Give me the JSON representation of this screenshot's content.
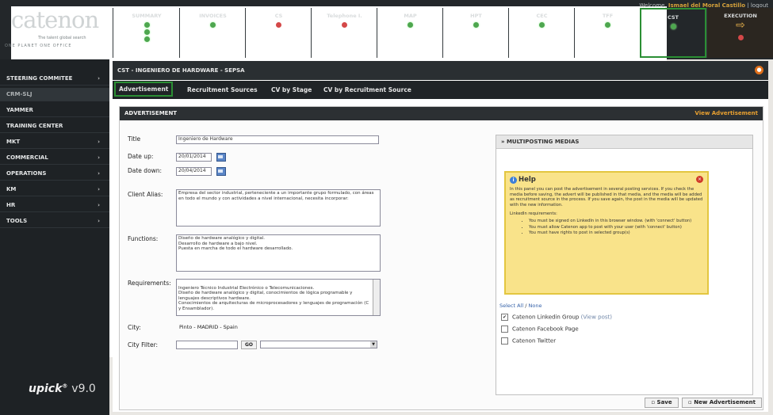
{
  "app": {
    "logo_text": "catenon",
    "logo_tagline": "The talent global search",
    "logo_subtagline": "ONE PLANET ONE OFFICE",
    "welcome_prefix": "Welcome,",
    "welcome_user": "Ismael del Moral Castillo",
    "welcome_suffix": "| logout",
    "product_name": "upick",
    "product_reg": "®",
    "product_version": "v9.0"
  },
  "topnav": [
    {
      "label": "SUMMARY",
      "status": [
        "green",
        "green",
        "green"
      ]
    },
    {
      "label": "INVOICES",
      "status": [
        "green"
      ]
    },
    {
      "label": "CS",
      "status": [
        "red"
      ]
    },
    {
      "label": "Telephone I.",
      "status": [
        "red"
      ]
    },
    {
      "label": "MAP",
      "status": [
        "green"
      ]
    },
    {
      "label": "HPT",
      "status": [
        "green"
      ]
    },
    {
      "label": "CEC",
      "status": [
        "green"
      ]
    },
    {
      "label": "TFF",
      "status": [
        "green"
      ]
    },
    {
      "label": "CST",
      "status": [
        "green"
      ],
      "selected": true
    },
    {
      "label": "EXECUTION",
      "status": [
        "red"
      ],
      "arrow": "⇨"
    }
  ],
  "sidebar": {
    "items": [
      {
        "label": "STEERING COMMITEE",
        "chevron": "›"
      },
      {
        "label": "CRM-SLJ",
        "chevron": ""
      },
      {
        "label": "YAMMER",
        "chevron": ""
      },
      {
        "label": "TRAINING CENTER",
        "chevron": ""
      },
      {
        "label": "MKT",
        "chevron": "›"
      },
      {
        "label": "COMMERCIAL",
        "chevron": "›"
      },
      {
        "label": "OPERATIONS",
        "chevron": "›"
      },
      {
        "label": "KM",
        "chevron": "›"
      },
      {
        "label": "HR",
        "chevron": "›"
      },
      {
        "label": "TOOLS",
        "chevron": "›"
      }
    ]
  },
  "page": {
    "title": "CST - INGENIERO DE HARDWARE - SEPSA",
    "alert_icon": "alert-icon",
    "tabs": [
      "Advertisement",
      "Recruitment Sources",
      "CV by Stage",
      "CV by Recruitment Source"
    ]
  },
  "advertisement": {
    "section_title": "ADVERTISEMENT",
    "view_link": "View Advertisement",
    "title_label": "Title",
    "title_value": "Ingeniero de Hardware",
    "date_up_label": "Date up:",
    "date_up_value": "20/01/2014",
    "date_down_label": "Date down:",
    "date_down_value": "20/04/2014",
    "client_alias_label": "Client Alias:",
    "client_alias_value": "Empresa del sector industrial, perteneciente a un importante grupo formulado, con áreas en todo el mundo y con actividades a nivel internacional, necesita incorporar:",
    "functions_label": "Functions:",
    "functions_value": "Diseño de hardware analógico y digital.\nDesarrollo de hardware a bajo nivel.\nPuesta en marcha de todo el hardware desarrollado.",
    "requirements_label": "Requirements:",
    "requirements_value": "Ingeniero Técnico Industrial Electrónico o Telecomunicaciones.\nDiseño de hardware analógico y digital, conocimientos de lógica programable y lenguajes descriptivos hardware.\nConocimientos de arquitecturas de microprocesadores y lenguajes de programación (C y Ensamblador).",
    "city_label": "City:",
    "city_value": "Pinto - MADRID - Spain",
    "city_filter_label": "City Filter:",
    "go_label": "GO",
    "save_label": "Save",
    "new_label": "New Advertisement"
  },
  "multiposting": {
    "title": "MULTIPOSTING MEDIAS",
    "help_title": "Help",
    "help_text": "In this panel you can post the advertisement in several posting services. If you check the media before saving, the advert will be published in that media, and the media will be added as recruitment source in the process. If you save again, the post in the media will be updated with the new information.",
    "linkedin_req_title": "LinkedIn requirements:",
    "requirements": [
      "You must be signed on LinkedIn in this browser window. (with 'connect' button)",
      "You must allow Catenon app to post with your user (with 'connect' button)",
      "You must have rights to post in selected group(s)"
    ],
    "select_all": "Select All",
    "select_none": "None",
    "options": [
      {
        "label": "Catenon Linkedin Group",
        "extra": "(View post)",
        "checked": true
      },
      {
        "label": "Catenon Facebook Page",
        "extra": "",
        "checked": false
      },
      {
        "label": "Catenon Twitter",
        "extra": "",
        "checked": false
      }
    ]
  }
}
